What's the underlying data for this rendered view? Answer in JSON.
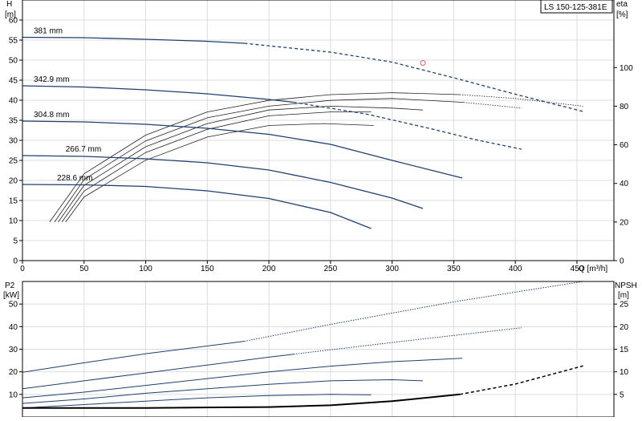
{
  "chart_data": [
    {
      "type": "line",
      "title": "LS 150-125-381E",
      "xlabel": "Q [m³/h]",
      "ylabel_top": "H",
      "ylabel_unit": "[m]",
      "y2label_top": "eta",
      "y2label_unit": "[%]",
      "xlim": [
        0,
        480
      ],
      "ylim": [
        0,
        65
      ],
      "y2lim": [
        0,
        135
      ],
      "grid": true,
      "x_ticks": [
        "0",
        "50",
        "100",
        "150",
        "200",
        "250",
        "300",
        "350",
        "400",
        "450"
      ],
      "y_ticks": [
        "0",
        "5",
        "10",
        "15",
        "20",
        "25",
        "30",
        "35",
        "40",
        "45",
        "50",
        "55",
        "60"
      ],
      "y2_ticks": [
        "0",
        "20",
        "40",
        "60",
        "80",
        "100"
      ],
      "curve_color": "#1f3f6e",
      "eta_color": "#222222",
      "marker_color": "#e06060",
      "head_curves": [
        {
          "label": "381 mm",
          "solid": [
            [
              0,
              55.7
            ],
            [
              50,
              55.6
            ],
            [
              100,
              55.2
            ],
            [
              150,
              54.7
            ],
            [
              180,
              54.2
            ]
          ],
          "dashed": [
            [
              180,
              54.2
            ],
            [
              250,
              52
            ],
            [
              300,
              49.5
            ],
            [
              350,
              45.6
            ],
            [
              400,
              41.5
            ],
            [
              455,
              37.2
            ]
          ]
        },
        {
          "label": "342.9 mm",
          "solid": [
            [
              0,
              43.6
            ],
            [
              50,
              43.3
            ],
            [
              100,
              42.6
            ],
            [
              150,
              41.6
            ],
            [
              200,
              40.2
            ],
            [
              220,
              39.5
            ]
          ],
          "dashed": [
            [
              220,
              39.5
            ],
            [
              280,
              36.5
            ],
            [
              330,
              33
            ],
            [
              370,
              30
            ],
            [
              405,
              27.8
            ]
          ]
        },
        {
          "label": "304.8 mm",
          "solid": [
            [
              0,
              34.8
            ],
            [
              50,
              34.6
            ],
            [
              100,
              34
            ],
            [
              150,
              33
            ],
            [
              200,
              31.5
            ],
            [
              250,
              29
            ],
            [
              300,
              25
            ],
            [
              357,
              20.6
            ]
          ],
          "dashed": []
        },
        {
          "label": "266.7 mm",
          "solid": [
            [
              0,
              26.2
            ],
            [
              50,
              26
            ],
            [
              100,
              25.4
            ],
            [
              150,
              24.4
            ],
            [
              200,
              22.6
            ],
            [
              250,
              19.5
            ],
            [
              300,
              15.6
            ],
            [
              325,
              13
            ]
          ],
          "dashed": []
        },
        {
          "label": "228.6 mm",
          "solid": [
            [
              0,
              19
            ],
            [
              50,
              18.9
            ],
            [
              100,
              18.5
            ],
            [
              150,
              17.4
            ],
            [
              200,
              15.5
            ],
            [
              250,
              12
            ],
            [
              283,
              8
            ]
          ],
          "dashed": []
        }
      ],
      "eta_curves": [
        {
          "solid": [
            [
              22,
              20
            ],
            [
              50,
              45
            ],
            [
              100,
              65
            ],
            [
              150,
              77
            ],
            [
              200,
              83
            ],
            [
              250,
              86
            ],
            [
              300,
              87
            ],
            [
              355,
              86
            ]
          ],
          "dotted": [
            [
              355,
              86
            ],
            [
              400,
              84
            ],
            [
              455,
              80
            ]
          ]
        },
        {
          "solid": [
            [
              26,
              20
            ],
            [
              50,
              42
            ],
            [
              100,
              62
            ],
            [
              150,
              74
            ],
            [
              200,
              80
            ],
            [
              250,
              83
            ],
            [
              300,
              84
            ],
            [
              358,
              82
            ]
          ],
          "dotted": [
            [
              358,
              82
            ],
            [
              405,
              79
            ]
          ]
        },
        {
          "solid": [
            [
              29,
              20
            ],
            [
              50,
              39
            ],
            [
              100,
              59
            ],
            [
              150,
              71
            ],
            [
              200,
              78
            ],
            [
              250,
              80
            ],
            [
              300,
              79
            ],
            [
              325,
              78
            ]
          ],
          "dotted": []
        },
        {
          "solid": [
            [
              32,
              20
            ],
            [
              50,
              36
            ],
            [
              100,
              56
            ],
            [
              150,
              68
            ],
            [
              200,
              75
            ],
            [
              250,
              77
            ],
            [
              283,
              77
            ]
          ],
          "dotted": []
        },
        {
          "solid": [
            [
              35,
              20
            ],
            [
              50,
              33
            ],
            [
              100,
              52
            ],
            [
              150,
              64
            ],
            [
              200,
              70
            ],
            [
              245,
              71
            ],
            [
              285,
              70
            ]
          ],
          "dotted": []
        }
      ],
      "duty_point": {
        "x": 325,
        "y": 49.3
      }
    },
    {
      "type": "line",
      "ylabel_top": "P2",
      "ylabel_unit": "[kW]",
      "y2label_top": "NPSH",
      "y2label_unit": "[m]",
      "xlim": [
        0,
        480
      ],
      "ylim": [
        0,
        60
      ],
      "y2lim": [
        0,
        30
      ],
      "grid": true,
      "y_ticks": [
        "10",
        "20",
        "30",
        "40",
        "50"
      ],
      "y2_ticks": [
        "5",
        "10",
        "15",
        "20",
        "25"
      ],
      "power_curves": [
        {
          "solid": [
            [
              0,
              19.8
            ],
            [
              50,
              24
            ],
            [
              100,
              28
            ],
            [
              180,
              33.5
            ]
          ],
          "dotted": [
            [
              180,
              33.5
            ],
            [
              250,
              41
            ],
            [
              350,
              51
            ],
            [
              455,
              60
            ]
          ]
        },
        {
          "solid": [
            [
              0,
              12.5
            ],
            [
              50,
              16
            ],
            [
              100,
              19.5
            ],
            [
              150,
              23
            ],
            [
              200,
              26.5
            ],
            [
              220,
              27.8
            ]
          ],
          "dotted": [
            [
              220,
              27.8
            ],
            [
              300,
              33
            ],
            [
              405,
              39.5
            ]
          ]
        },
        {
          "solid": [
            [
              0,
              8.5
            ],
            [
              50,
              11
            ],
            [
              100,
              14
            ],
            [
              150,
              17
            ],
            [
              200,
              20
            ],
            [
              250,
              22.5
            ],
            [
              300,
              24.5
            ],
            [
              357,
              26
            ]
          ],
          "dotted": []
        },
        {
          "solid": [
            [
              0,
              6
            ],
            [
              50,
              8
            ],
            [
              100,
              10.5
            ],
            [
              150,
              12.5
            ],
            [
              200,
              14.5
            ],
            [
              250,
              16
            ],
            [
              300,
              16.5
            ],
            [
              325,
              16
            ]
          ],
          "dotted": []
        },
        {
          "solid": [
            [
              0,
              4
            ],
            [
              50,
              5.5
            ],
            [
              100,
              7
            ],
            [
              150,
              8.5
            ],
            [
              200,
              9.5
            ],
            [
              250,
              10
            ],
            [
              283,
              9.8
            ]
          ],
          "dotted": []
        }
      ],
      "npsh_curve": {
        "solid": [
          [
            0,
            2
          ],
          [
            100,
            2
          ],
          [
            200,
            2.2
          ],
          [
            250,
            2.6
          ],
          [
            300,
            3.5
          ],
          [
            355,
            5
          ]
        ],
        "dashed": [
          [
            355,
            5
          ],
          [
            400,
            7.3
          ],
          [
            455,
            11.3
          ]
        ]
      }
    }
  ]
}
